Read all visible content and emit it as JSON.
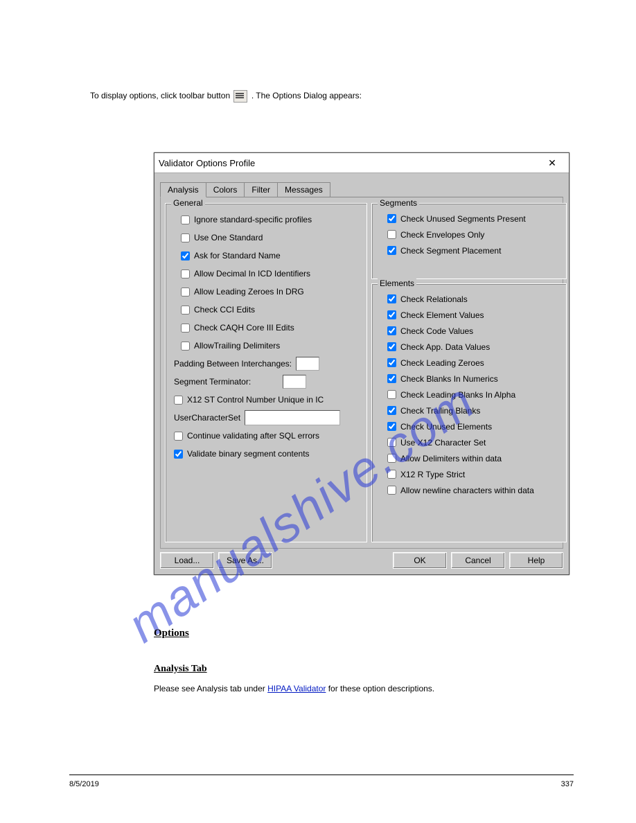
{
  "intro": {
    "prefix": "To display options, click toolbar button",
    "icon_name": "options-icon",
    "suffix": ". The Options Dialog appears:"
  },
  "dialog": {
    "title": "Validator Options Profile",
    "tabs": [
      "Analysis",
      "Colors",
      "Filter",
      "Messages"
    ],
    "active_tab": 0,
    "groups": {
      "general": {
        "title": "General",
        "items": [
          {
            "label": "Ignore standard-specific profiles",
            "checked": false
          },
          {
            "label": "Use One Standard",
            "checked": false
          },
          {
            "label": "Ask for Standard Name",
            "checked": true
          },
          {
            "label": "Allow Decimal In ICD Identifiers",
            "checked": false
          },
          {
            "label": "Allow Leading Zeroes In DRG",
            "checked": false
          },
          {
            "label": "Check CCI Edits",
            "checked": false
          },
          {
            "label": "Check CAQH Core III Edits",
            "checked": false
          },
          {
            "label": "AllowTrailing Delimiters",
            "checked": false
          }
        ],
        "padding_label": "Padding Between Interchanges:",
        "padding_value": "",
        "segterm_label": "Segment Terminator:",
        "segterm_value": "",
        "x12ctrl": {
          "label": "X12 ST Control Number Unique in IC",
          "checked": false
        },
        "charset_label": "UserCharacterSet",
        "charset_value": "",
        "continue_sql": {
          "label": "Continue validating after SQL errors",
          "checked": false
        },
        "validate_binary": {
          "label": "Validate binary segment contents",
          "checked": true
        }
      },
      "segments": {
        "title": "Segments",
        "items": [
          {
            "label": "Check Unused Segments Present",
            "checked": true
          },
          {
            "label": "Check Envelopes Only",
            "checked": false
          },
          {
            "label": "Check Segment Placement",
            "checked": true
          }
        ]
      },
      "elements": {
        "title": "Elements",
        "items": [
          {
            "label": "Check Relationals",
            "checked": true
          },
          {
            "label": "Check Element Values",
            "checked": true
          },
          {
            "label": "Check Code Values",
            "checked": true
          },
          {
            "label": "Check App. Data Values",
            "checked": true
          },
          {
            "label": "Check Leading Zeroes",
            "checked": true
          },
          {
            "label": "Check Blanks In Numerics",
            "checked": true
          },
          {
            "label": "Check Leading Blanks In Alpha",
            "checked": false
          },
          {
            "label": "Check Trailing Blanks",
            "checked": true
          },
          {
            "label": "Check Unused Elements",
            "checked": true
          },
          {
            "label": "Use  X12 Character Set",
            "checked": false
          },
          {
            "label": "Allow Delimiters within data",
            "checked": false
          },
          {
            "label": "X12 R Type Strict",
            "checked": false
          },
          {
            "label": "Allow newline characters within data",
            "checked": false
          }
        ]
      }
    },
    "buttons": {
      "load": "Load...",
      "save_as": "Save As...",
      "ok": "OK",
      "cancel": "Cancel",
      "help": "Help"
    }
  },
  "content": {
    "options_heading": "Options",
    "analysis_tab_heading": "Analysis Tab",
    "analysis_paragraph_1": "Please see Analysis tab under ",
    "analysis_link": "HIPAA Validator",
    "analysis_paragraph_2": " for these option descriptions."
  },
  "footer": {
    "left": "8/5/2019",
    "right": "337"
  },
  "watermark": "manualshive.com"
}
